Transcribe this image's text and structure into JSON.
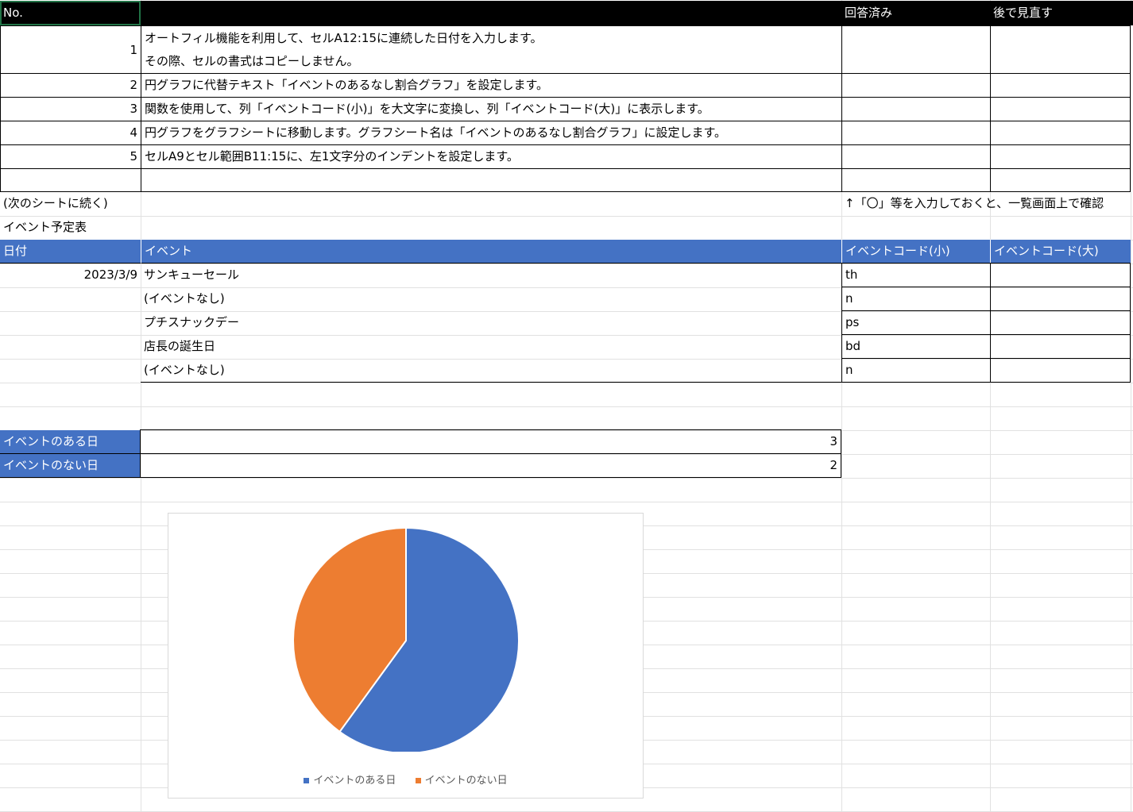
{
  "header": {
    "no_label": "No.",
    "answered_label": "回答済み",
    "review_label": "後で見直す"
  },
  "tasks": [
    {
      "no": "1",
      "line1": "オートフィル機能を利用して、セルA12:15に連続した日付を入力します。",
      "line2": "その際、セルの書式はコピーしません。"
    },
    {
      "no": "2",
      "text": "円グラフに代替テキスト「イベントのあるなし割合グラフ」を設定します。"
    },
    {
      "no": "3",
      "text": "関数を使用して、列「イベントコード(小)」を大文字に変換し、列「イベントコード(大)」に表示します。"
    },
    {
      "no": "4",
      "text": "円グラフをグラフシートに移動します。グラフシート名は「イベントのあるなし割合グラフ」に設定します。"
    },
    {
      "no": "5",
      "text": "セルA9とセル範囲B11:15に、左1文字分のインデントを設定します。"
    }
  ],
  "notes": {
    "continue": "(次のシートに続く)",
    "hint": "↑「〇」等を入力しておくと、一覧画面上で確認"
  },
  "schedule": {
    "title": "イベント予定表",
    "columns": [
      "日付",
      "イベント",
      "イベントコード(小)",
      "イベントコード(大)"
    ],
    "rows": [
      {
        "date": "2023/3/9",
        "event": "サンキューセール",
        "code_small": "th",
        "code_large": ""
      },
      {
        "date": "",
        "event": "(イベントなし)",
        "code_small": "n",
        "code_large": ""
      },
      {
        "date": "",
        "event": "プチスナックデー",
        "code_small": "ps",
        "code_large": ""
      },
      {
        "date": "",
        "event": "店長の誕生日",
        "code_small": "bd",
        "code_large": ""
      },
      {
        "date": "",
        "event": "(イベントなし)",
        "code_small": "n",
        "code_large": ""
      }
    ]
  },
  "summary": [
    {
      "label": "イベントのある日",
      "value": "3"
    },
    {
      "label": "イベントのない日",
      "value": "2"
    }
  ],
  "chart_data": {
    "type": "pie",
    "categories": [
      "イベントのある日",
      "イベントのない日"
    ],
    "values": [
      3,
      2
    ],
    "colors": [
      "#4472c4",
      "#ed7d31"
    ],
    "legend": "bottom"
  }
}
